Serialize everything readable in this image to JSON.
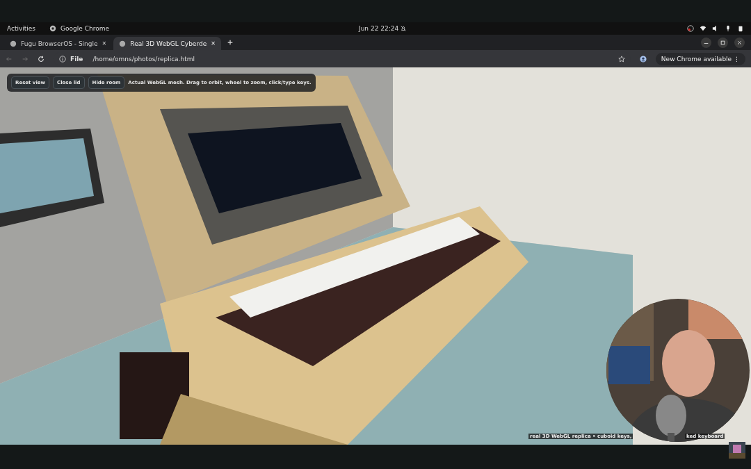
{
  "top_bar": {
    "activities": "Activities",
    "app": "Google Chrome",
    "clock": "Jun 22  22:24"
  },
  "tabs": [
    {
      "title": "Fugu BrowserOS - Single",
      "close": "✕",
      "selected": false
    },
    {
      "title": "Real 3D WebGL Cyberde",
      "close": "✕",
      "selected": true
    }
  ],
  "address_bar": {
    "scheme": "File",
    "url": "/home/omns/photos/replica.html",
    "update": "New Chrome available",
    "menu": "⋮"
  },
  "toolbar": {
    "buttons": [
      "Reset view",
      "Close lid",
      "Hide room"
    ],
    "hint": "Actual WebGL mesh. Drag to orbit, wheel to zoom, click/type keys."
  },
  "caption": [
    "real 3D WebGL replica • cuboid keys,",
    "ked keyboard"
  ]
}
